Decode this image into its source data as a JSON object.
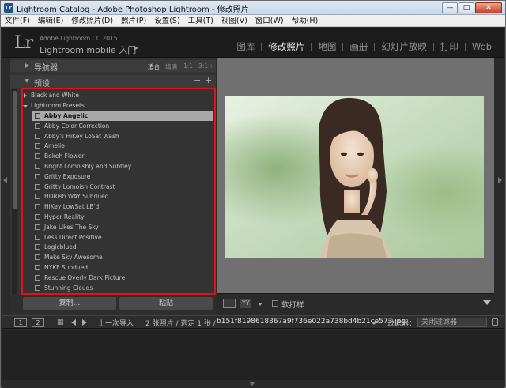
{
  "window": {
    "title": "Lightroom Catalog - Adobe Photoshop Lightroom - 修改照片",
    "app_icon": "Lr",
    "buttons": {
      "minimize": "—",
      "maximize": "□",
      "close": "✕"
    }
  },
  "menu": [
    "文件(F)",
    "编辑(E)",
    "修改照片(D)",
    "照片(P)",
    "设置(S)",
    "工具(T)",
    "视图(V)",
    "窗口(W)",
    "帮助(H)"
  ],
  "identity": {
    "logo": "Lr",
    "small": "Adobe Lightroom CC 2015",
    "main": "Lightroom mobile 入门",
    "arrow": "▶"
  },
  "modules": [
    {
      "label": "图库",
      "active": false
    },
    {
      "label": "修改照片",
      "active": true
    },
    {
      "label": "地图",
      "active": false
    },
    {
      "label": "画册",
      "active": false
    },
    {
      "label": "幻灯片放映",
      "active": false
    },
    {
      "label": "打印",
      "active": false
    },
    {
      "label": "Web",
      "active": false
    }
  ],
  "navigator": {
    "label": "导航器",
    "zoom_options": [
      "适合",
      "填满",
      "1:1",
      "3:1"
    ],
    "selected_zoom": "适合",
    "zoom_arrow": "÷"
  },
  "presets": {
    "label": "预设",
    "minus": "−",
    "plus": "+",
    "groups": [
      {
        "label": "Black and White",
        "expanded": false
      },
      {
        "label": "Lightroom Presets",
        "expanded": true
      }
    ],
    "items": [
      {
        "label": "Abby Angelic",
        "selected": true
      },
      {
        "label": "Abby Color Correction",
        "selected": false
      },
      {
        "label": "Abby's HiKey LoSat Wash",
        "selected": false
      },
      {
        "label": "Amelie",
        "selected": false
      },
      {
        "label": "Bokeh Flower",
        "selected": false
      },
      {
        "label": "Bright Lomoishly and Subtley",
        "selected": false
      },
      {
        "label": "Gritty Exposure",
        "selected": false
      },
      {
        "label": "Gritty Lomoish Contrast",
        "selected": false
      },
      {
        "label": "HDRish WAY Subdued",
        "selected": false
      },
      {
        "label": "HiKey LowSat LB'd",
        "selected": false
      },
      {
        "label": "Hyper Reality",
        "selected": false
      },
      {
        "label": "Jake Likes The Sky",
        "selected": false
      },
      {
        "label": "Less Direct Positive",
        "selected": false
      },
      {
        "label": "Logicblued",
        "selected": false
      },
      {
        "label": "Make Sky Awesome",
        "selected": false
      },
      {
        "label": "NYKF Subdued",
        "selected": false
      },
      {
        "label": "Rescue Overly Dark Picture",
        "selected": false
      },
      {
        "label": "Stunning Clouds",
        "selected": false
      }
    ]
  },
  "copy_paste": {
    "copy": "复制...",
    "paste": "粘贴"
  },
  "toolbar": {
    "yy": "YY",
    "soft_proof": "软打样"
  },
  "filmstrip_bar": {
    "btn1": "1",
    "btn2": "2",
    "source": "上一次导入",
    "count": "2 张照片 / 选定 1 张 /",
    "filename": "b151f8198618367a9f736e022a738bd4b21ce573.jpg",
    "filter_label": "过滤器：",
    "filter_value": "关闭过滤器"
  },
  "colors": {
    "highlight_box": "#e0101c",
    "panel_bg": "#333333",
    "preview_bg": "#707070"
  }
}
